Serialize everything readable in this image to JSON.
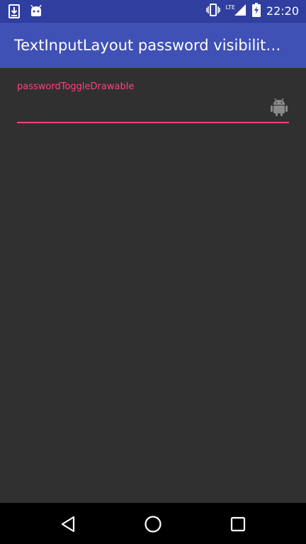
{
  "status_bar": {
    "time": "22:20",
    "network_label": "LTE",
    "icons": [
      "download-icon",
      "android-notification-icon",
      "vibrate-icon",
      "signal-icon",
      "battery-icon"
    ]
  },
  "app_bar": {
    "title": "TextInputLayout password visibilit…"
  },
  "password_field": {
    "label": "passwordToggleDrawable",
    "value": "",
    "toggle_icon": "android-icon"
  },
  "nav_bar": {
    "buttons": [
      "back-icon",
      "home-icon",
      "recents-icon"
    ]
  },
  "colors": {
    "primary": "#3f51b5",
    "primary_dark": "#303f9f",
    "accent": "#ff4081",
    "background": "#303030"
  }
}
